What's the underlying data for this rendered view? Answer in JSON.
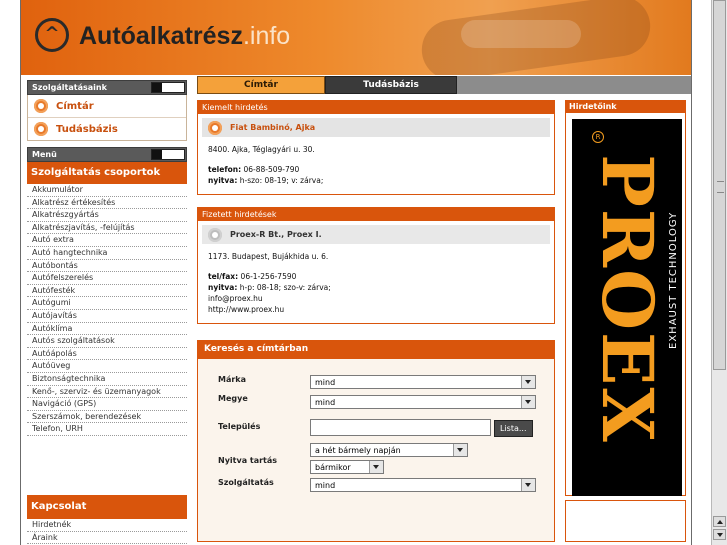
{
  "header": {
    "brand_bold": "Autóalkatrész",
    "brand_tld": ".info"
  },
  "tabs": [
    {
      "label": "Címtár"
    },
    {
      "label": "Tudásbázis"
    }
  ],
  "services": {
    "title": "Szolgáltatásaink",
    "items": [
      {
        "label": "Címtár"
      },
      {
        "label": "Tudásbázis"
      }
    ]
  },
  "menu": {
    "title": "Menü",
    "group_title": "Szolgáltatás csoportok",
    "items": [
      "Akkumulátor",
      "Alkatrész értékesítés",
      "Alkatrészgyártás",
      "Alkatrészjavítás, -felújítás",
      "Autó extra",
      "Autó hangtechnika",
      "Autóbontás",
      "Autófelszerelés",
      "Autófesték",
      "Autógumi",
      "Autójavítás",
      "Autóklíma",
      "Autós szolgáltatások",
      "Autóápolás",
      "Autóüveg",
      "Biztonságtechnika",
      "Kenő-, szerviz- és üzemanyagok",
      "Navigáció (GPS)",
      "Szerszámok, berendezések",
      "Telefon, URH"
    ]
  },
  "contact": {
    "title": "Kapcsolat",
    "items": [
      "Hirdetnék",
      "Áraink"
    ]
  },
  "featured_ad": {
    "header": "Kiemelt hirdetés",
    "name": "Fiat Bambinó, Ajka",
    "address": "8400. Ajka, Téglagyári u. 30.",
    "phone_label": "telefon:",
    "phone": "06-88-509-790",
    "hours_label": "nyitva:",
    "hours": "h-szo: 08-19; v: zárva;"
  },
  "paid_ad": {
    "header": "Fizetett hirdetések",
    "name": "Proex-R Bt., Proex I.",
    "address": "1173. Budapest, Bujákhida u. 6.",
    "phone_label": "tel/fax:",
    "phone": "06-1-256-7590",
    "hours_label": "nyitva:",
    "hours": "h-p: 08-18; szo-v: zárva;",
    "email": "info@proex.hu",
    "web": "http://www.proex.hu"
  },
  "search": {
    "title": "Keresés a címtárban",
    "make_label": "Márka",
    "make_value": "mind",
    "county_label": "Megye",
    "county_value": "mind",
    "city_label": "Település",
    "city_value": "",
    "list_button": "Lista...",
    "open_label": "Nyitva tartás",
    "open_day": "a hét bármely napján",
    "open_time": "bármikor",
    "service_label": "Szolgáltatás",
    "service_value": "mind"
  },
  "ads_right": {
    "title": "Hirdetőink",
    "banner_text": "PROEX",
    "banner_sub": "EXHAUST TECHNOLOGY",
    "banner_reg": "R",
    "colors": {
      "banner_bg": "#000000",
      "banner_fg": "#f39c1f"
    }
  },
  "colors": {
    "accent": "#d9550c",
    "tab_active": "#f4a13a",
    "tab_dark": "#3a3a3a"
  }
}
